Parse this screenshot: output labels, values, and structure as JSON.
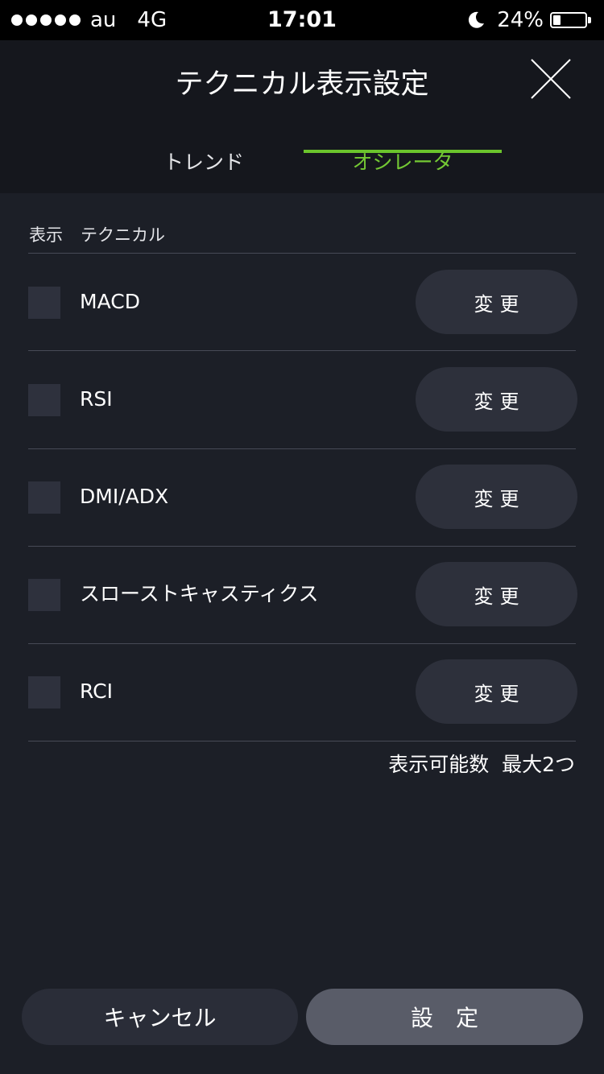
{
  "status_bar": {
    "carrier": "au",
    "network": "4G",
    "time": "17:01",
    "battery": "24%",
    "battery_level": 0.24
  },
  "header": {
    "title": "テクニカル表示設定",
    "close_icon": "close-x-icon"
  },
  "tabs": [
    {
      "label": "トレンド",
      "active": false
    },
    {
      "label": "オシレータ",
      "active": true
    }
  ],
  "list_header": {
    "col_display": "表示",
    "col_technical": "テクニカル"
  },
  "indicators": [
    {
      "name": "MACD",
      "checked": false,
      "button": "変更"
    },
    {
      "name": "RSI",
      "checked": false,
      "button": "変更"
    },
    {
      "name": "DMI/ADX",
      "checked": false,
      "button": "変更"
    },
    {
      "name": "スローストキャスティクス",
      "checked": false,
      "button": "変更"
    },
    {
      "name": "RCI",
      "checked": false,
      "button": "変更"
    }
  ],
  "max_note": "表示可能数  最大2つ",
  "footer": {
    "cancel_label": "キャンセル",
    "set_label": "設　定"
  },
  "colors": {
    "background": "#1c1f27",
    "header_background": "#15171d",
    "accent_green": "#6bc42c",
    "button_dark": "#2d303b",
    "set_button": "#595c68"
  }
}
